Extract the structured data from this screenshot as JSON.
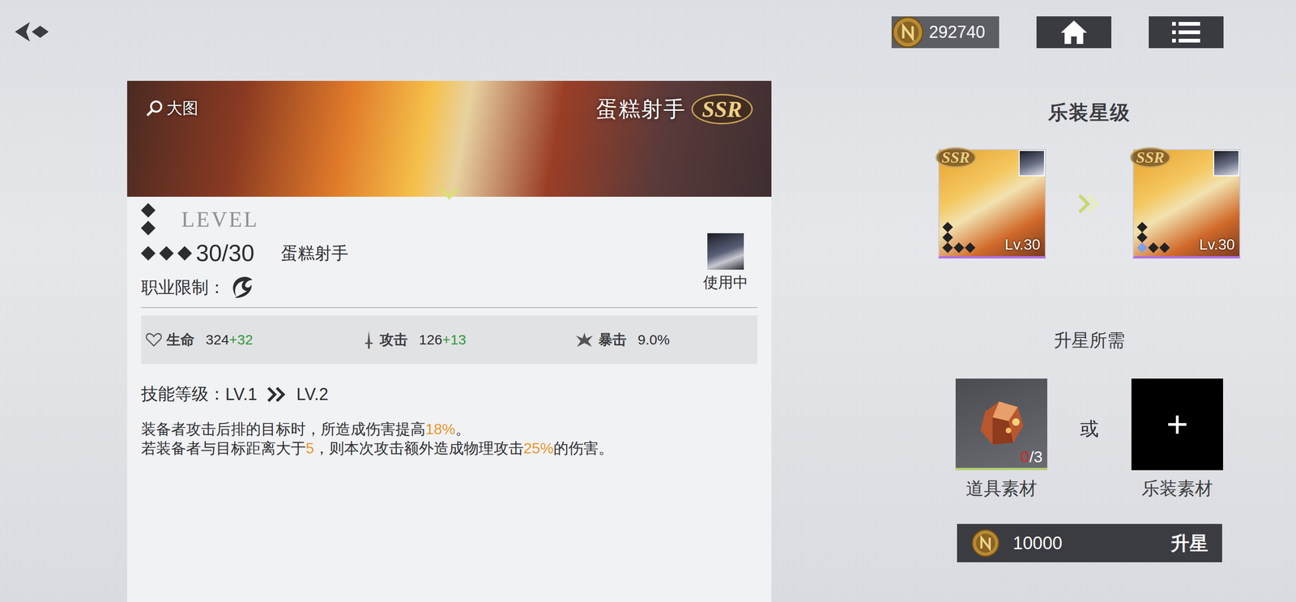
{
  "top_bar": {
    "currency": "292740"
  },
  "equipment": {
    "banner": {
      "zoom_label": "大图",
      "title": "蛋糕射手",
      "rarity": "SSR"
    },
    "level_word": "LEVEL",
    "level": "30/30",
    "stars": 0,
    "max_stars": 5,
    "name": "蛋糕射手",
    "class_label": "职业限制：",
    "equipped_label": "使用中",
    "stats": [
      {
        "kind": "hp",
        "label": "生命",
        "value": "324",
        "bonus": "+32"
      },
      {
        "kind": "atk",
        "label": "攻击",
        "value": "126",
        "bonus": "+13"
      },
      {
        "kind": "crit",
        "label": "暴击",
        "value": "9.0%"
      }
    ],
    "skill": {
      "label": "技能等级：",
      "from": "LV.1",
      "to": "LV.2"
    },
    "description": [
      [
        {
          "text": "装备者攻击后排的目标时，所造成伤害提高",
          "highlight": false
        },
        {
          "text": "18%",
          "highlight": true
        },
        {
          "text": "。",
          "highlight": false
        }
      ],
      [
        {
          "text": "若装备者与目标距离大于",
          "highlight": false
        },
        {
          "text": "5",
          "highlight": true
        },
        {
          "text": "，则本次攻击额外造成物理攻击",
          "highlight": false
        },
        {
          "text": "25%",
          "highlight": true
        },
        {
          "text": "的伤害。",
          "highlight": false
        }
      ]
    ]
  },
  "star_panel": {
    "title": "乐装星级",
    "cards": [
      {
        "rarity": "SSR",
        "level": "Lv.30",
        "stars": 0,
        "max_stars": 5
      },
      {
        "rarity": "SSR",
        "level": "Lv.30",
        "stars": 1,
        "max_stars": 5
      }
    ],
    "requirement_title": "升星所需",
    "item": {
      "owned": "0",
      "required": "/3",
      "label": "道具素材",
      "sufficient": false
    },
    "separator": "或",
    "gear": {
      "symbol": "+",
      "label": "乐装素材"
    },
    "upgrade": {
      "cost": "10000",
      "label": "升星"
    }
  }
}
